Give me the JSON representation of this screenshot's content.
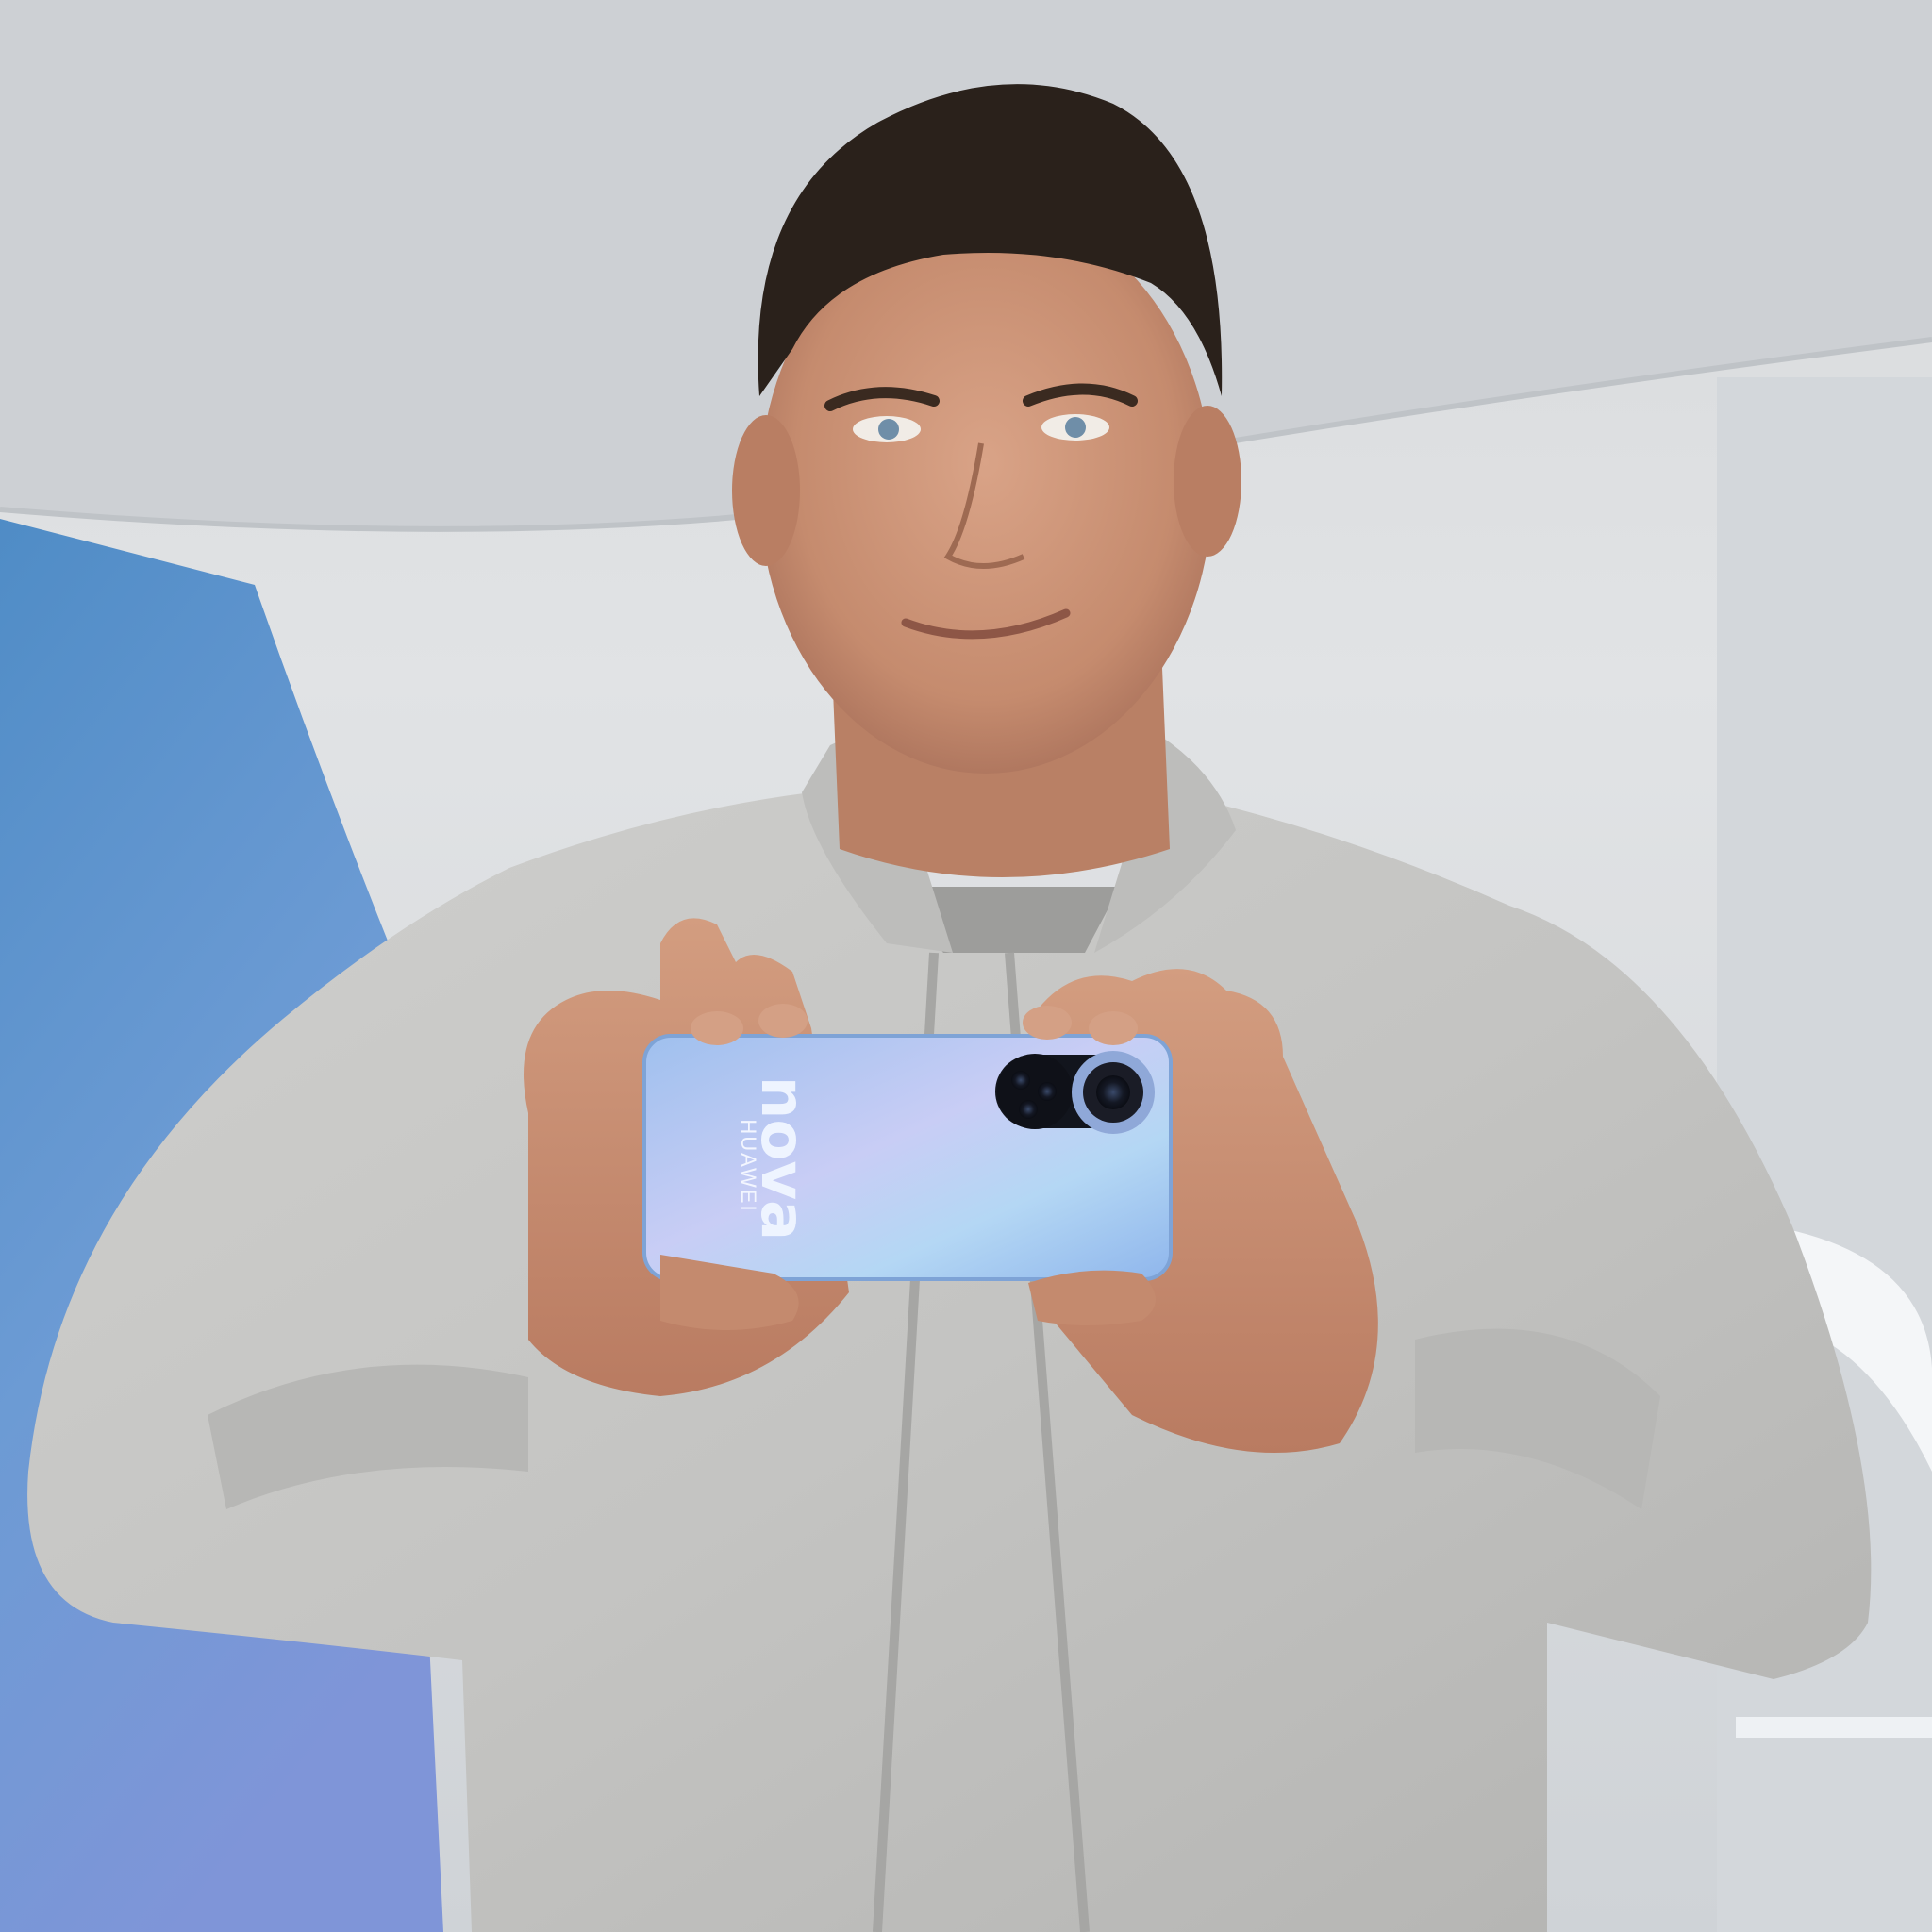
{
  "scene": {
    "subject": "person-holding-smartphone",
    "colors": {
      "wall": "#e2e4e6",
      "ceiling": "#cfd2d6",
      "blue_panel": "#5a8fc7",
      "jacket": "#c6c6c4",
      "shirt": "#9c9c9a",
      "skin": "#c98f72",
      "hair": "#2a211b",
      "phone_body": "#a6c6f2",
      "camera_ring": "#1a1c26"
    }
  },
  "phone": {
    "brand": "HUAWEI",
    "model_mark": "nova"
  }
}
